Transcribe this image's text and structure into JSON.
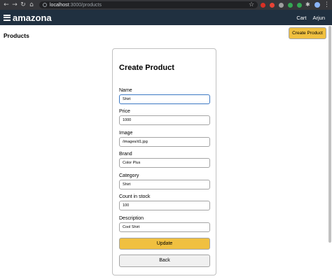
{
  "browser": {
    "url_host": "localhost",
    "url_path": ":3000/products",
    "extension_colors": [
      "#d93025",
      "#ea4335",
      "#9e9e9e",
      "#34a853",
      "#34a853"
    ]
  },
  "header": {
    "brand": "amazona",
    "links": [
      "Cart",
      "Arjun"
    ]
  },
  "page": {
    "title": "Products",
    "create_button": "Create Product"
  },
  "form": {
    "heading": "Create Product",
    "fields": [
      {
        "label": "Name",
        "value": "Shirt"
      },
      {
        "label": "Price",
        "value": "1000"
      },
      {
        "label": "Image",
        "value": "/images/d1.jpg"
      },
      {
        "label": "Brand",
        "value": "Color Plus"
      },
      {
        "label": "Category",
        "value": "Shirt"
      },
      {
        "label": "Count in stock",
        "value": "100"
      },
      {
        "label": "Description",
        "value": "Cool Shirt"
      }
    ],
    "submit_label": "Update",
    "back_label": "Back"
  }
}
